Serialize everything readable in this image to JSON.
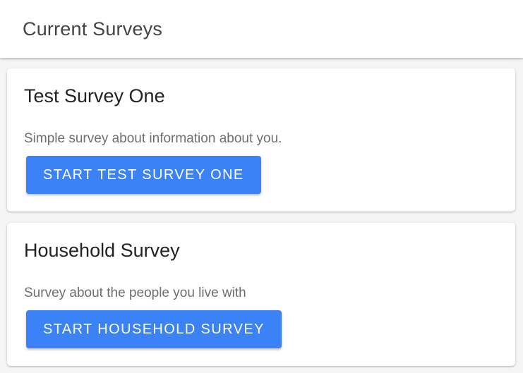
{
  "header": {
    "title": "Current Surveys"
  },
  "surveys": [
    {
      "title": "Test Survey One",
      "description": "Simple survey about information about you.",
      "button_label": "START TEST SURVEY ONE"
    },
    {
      "title": "Household Survey",
      "description": "Survey about the people you live with",
      "button_label": "START HOUSEHOLD SURVEY"
    }
  ],
  "colors": {
    "accent": "#3b82f6",
    "title_text": "#222222",
    "description_text": "#6f6f6f",
    "app_bar_text": "#444444",
    "background": "#f5f5f5"
  }
}
